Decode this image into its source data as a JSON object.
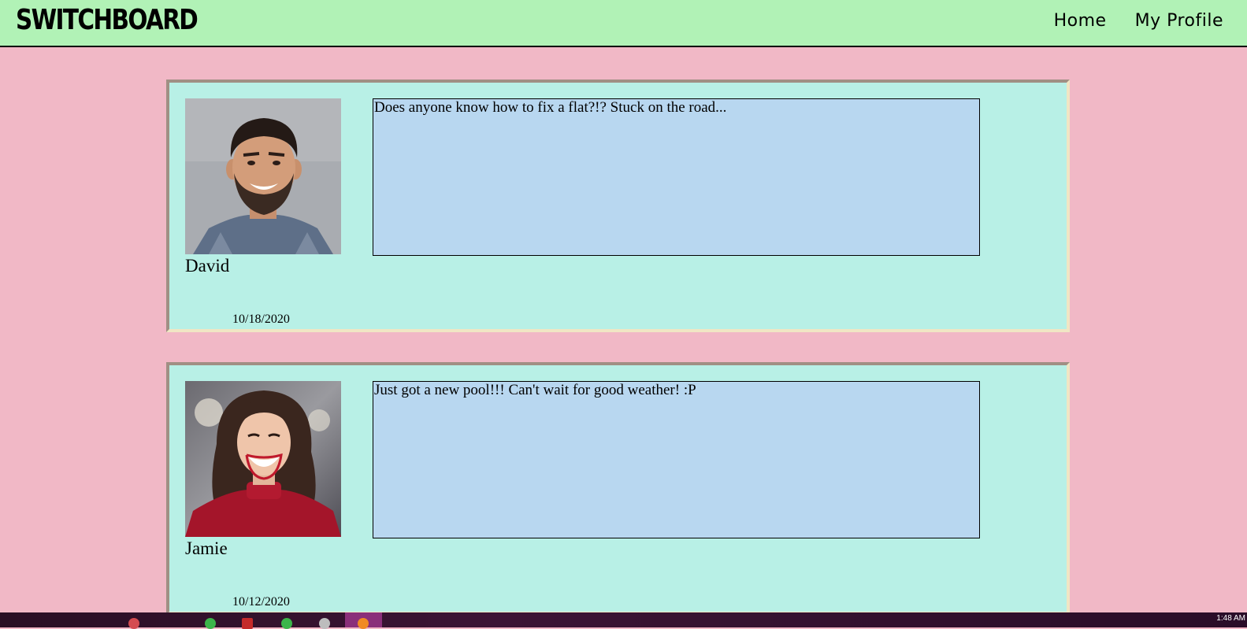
{
  "app": {
    "brand": "SWITCHBOARD"
  },
  "nav": {
    "items": [
      {
        "label": "Home"
      },
      {
        "label": "My Profile"
      }
    ]
  },
  "posts": [
    {
      "author": "David",
      "message": "Does anyone know how to fix a flat?!? Stuck on the road...",
      "date": "10/18/2020"
    },
    {
      "author": "Jamie",
      "message": "Just got a new pool!!! Can't wait for good weather! :P",
      "date": "10/12/2020"
    }
  ],
  "taskbar": {
    "clock": "1:48 AM"
  },
  "colors": {
    "page_bg": "#f1b8c6",
    "navbar_bg": "#b1f2b6",
    "card_bg": "#b8f0e6",
    "message_bg": "#b8d7f0"
  }
}
